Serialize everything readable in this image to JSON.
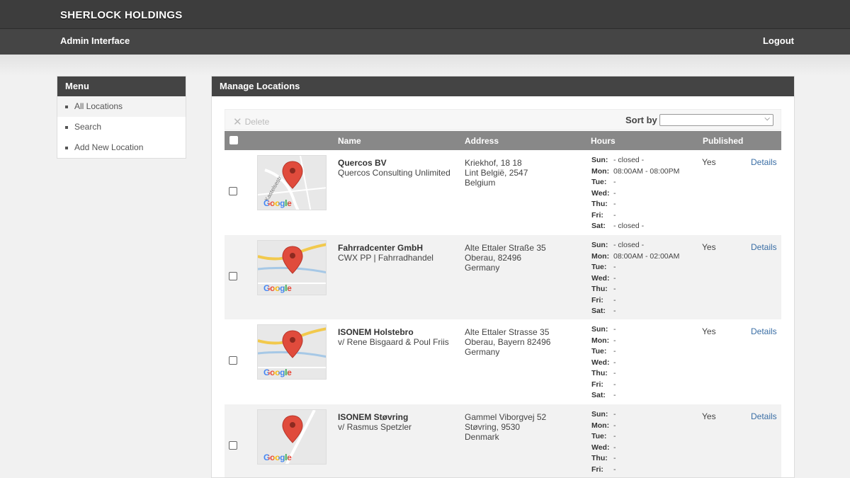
{
  "header": {
    "brand": "SHERLOCK HOLDINGS",
    "subtitle": "Admin Interface",
    "logout": "Logout"
  },
  "sidebar": {
    "title": "Menu",
    "items": [
      {
        "label": "All Locations"
      },
      {
        "label": "Search"
      },
      {
        "label": "Add New Location"
      }
    ]
  },
  "main": {
    "title": "Manage Locations",
    "toolbar": {
      "delete_label": "Delete",
      "sort_label": "Sort by",
      "sort_value": ""
    },
    "columns": {
      "name": "Name",
      "address": "Address",
      "hours": "Hours",
      "published": "Published"
    },
    "day_labels": [
      "Sun:",
      "Mon:",
      "Tue:",
      "Wed:",
      "Thu:",
      "Fri:",
      "Sat:"
    ],
    "rows": [
      {
        "name": "Quercos BV",
        "company": "Quercos Consulting Unlimited",
        "address": [
          "Kriekhof, 18 18",
          "Lint België, 2547",
          "Belgium"
        ],
        "hours": [
          "- closed -",
          "08:00AM - 08:00PM",
          "-",
          "-",
          "-",
          "-",
          "- closed -"
        ],
        "published": "Yes",
        "details": "Details",
        "map_label": "Google",
        "map_street": "Kastelsestr"
      },
      {
        "name": "Fahrradcenter GmbH",
        "company": "CWX PP | Fahrradhandel",
        "address": [
          "Alte Ettaler Straße 35",
          "Oberau, 82496",
          "Germany"
        ],
        "hours": [
          "- closed -",
          "08:00AM - 02:00AM",
          "-",
          "-",
          "-",
          "-",
          "-"
        ],
        "published": "Yes",
        "details": "Details",
        "map_label": "Google"
      },
      {
        "name": "ISONEM Holstebro",
        "company": "v/ Rene Bisgaard & Poul Friis",
        "address": [
          "Alte Ettaler Strasse 35",
          "Oberau, Bayern 82496",
          "Germany"
        ],
        "hours": [
          "-",
          "-",
          "-",
          "-",
          "-",
          "-",
          "-"
        ],
        "published": "Yes",
        "details": "Details",
        "map_label": "Google"
      },
      {
        "name": "ISONEM Støvring",
        "company": "v/ Rasmus Spetzler",
        "address": [
          "Gammel Viborgvej 52",
          "Støvring, 9530",
          "Denmark"
        ],
        "hours": [
          "-",
          "-",
          "-",
          "-",
          "-",
          "-",
          "-"
        ],
        "published": "Yes",
        "details": "Details",
        "map_label": "Google"
      }
    ]
  }
}
